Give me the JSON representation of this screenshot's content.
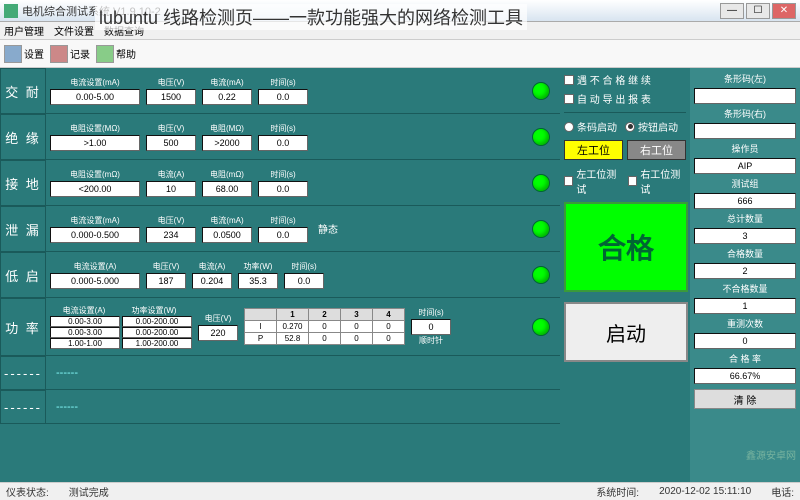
{
  "window": {
    "title": "电机综合测试系统 V1.9.10-2"
  },
  "overlay": "lubuntu 线路检测页——一款功能强大的网络检测工具",
  "menu": [
    "用户管理",
    "文件设置",
    "数据查询"
  ],
  "toolbar": {
    "set": "设置",
    "rec": "记录",
    "help": "帮助"
  },
  "rows": {
    "r1": {
      "name": "交 耐",
      "curr_set_lbl": "电流设置(mA)",
      "curr_set": "0.00-5.00",
      "volt_lbl": "电压(V)",
      "volt": "1500",
      "curr_lbl": "电流(mA)",
      "curr": "0.22",
      "time_lbl": "时间(s)",
      "time": "0.0"
    },
    "r2": {
      "name": "绝 缘",
      "res_set_lbl": "电阻设置(MΩ)",
      "res_set": ">1.00",
      "volt_lbl": "电压(V)",
      "volt": "500",
      "res_lbl": "电阻(MΩ)",
      "res": ">2000",
      "time_lbl": "时间(s)",
      "time": "0.0"
    },
    "r3": {
      "name": "接 地",
      "res_set_lbl": "电阻设置(mΩ)",
      "res_set": "<200.00",
      "curr_lbl": "电流(A)",
      "curr": "10",
      "res_lbl": "电阻(mΩ)",
      "res": "68.00",
      "time_lbl": "时间(s)",
      "time": "0.0"
    },
    "r4": {
      "name": "泄 漏",
      "curr_set_lbl": "电流设置(mA)",
      "curr_set": "0.000-0.500",
      "volt_lbl": "电压(V)",
      "volt": "234",
      "curr_lbl": "电流(mA)",
      "curr": "0.0500",
      "time_lbl": "时间(s)",
      "time": "0.0",
      "side": "静态"
    },
    "r5": {
      "name": "低 启",
      "curr_set_lbl": "电流设置(A)",
      "curr_set": "0.000-5.000",
      "volt_lbl": "电压(V)",
      "volt": "187",
      "curr_lbl": "电流(A)",
      "curr": "0.204",
      "pow_lbl": "功率(W)",
      "pow": "35.3",
      "time_lbl": "时间(s)",
      "time": "0.0"
    },
    "r6": {
      "name": "功 率",
      "set1_lbl": "电流设置(A)",
      "set2_lbl": "功率设置(W)",
      "set1a": "0.00-3.00",
      "set1b": "0.00-200.00",
      "set2a": "0.00-3.00",
      "set2b": "0.00-200.00",
      "set3a": "1.00-1.00",
      "set3b": "1.00-200.00",
      "volt_lbl": "电压(V)",
      "volt": "220",
      "tbl_h1": "1",
      "tbl_h2": "2",
      "tbl_h3": "3",
      "tbl_h4": "4",
      "irow_lbl": "I",
      "prow_lbl": "P",
      "i1": "0.270",
      "i2": "0",
      "i3": "0",
      "i4": "0",
      "p1": "52.8",
      "p2": "0",
      "p3": "0",
      "p4": "0",
      "time_lbl": "时间(s)",
      "time": "0",
      "dir": "顺时针"
    }
  },
  "empty": "------",
  "right": {
    "chk1": "遇 不 合 格 继 续",
    "chk2": "自 动 导 出 报 表",
    "rad1": "条码启动",
    "rad2": "按钮启动",
    "stL": "左工位",
    "stR": "右工位",
    "chkL": "左工位测试",
    "chkR": "右工位测试",
    "result": "合格",
    "start": "启动"
  },
  "info": {
    "bcL_lbl": "条形码(左)",
    "bcL": "",
    "bcR_lbl": "条形码(右)",
    "bcR": "",
    "op_lbl": "操作员",
    "op": "AIP",
    "grp_lbl": "测试组",
    "grp": "666",
    "tot_lbl": "总计数量",
    "tot": "3",
    "pass_lbl": "合格数量",
    "pass": "2",
    "fail_lbl": "不合格数量",
    "fail": "1",
    "retest_lbl": "重测次数",
    "retest": "0",
    "rate_lbl": "合 格 率",
    "rate": "66.67%",
    "clear": "清 除"
  },
  "status": {
    "state_lbl": "仪表状态:",
    "state": "测试完成",
    "time_lbl": "系统时间:",
    "time": "2020-12-02 15:11:10",
    "tel_lbl": "电话:"
  },
  "watermark": "鑫源安卓网"
}
